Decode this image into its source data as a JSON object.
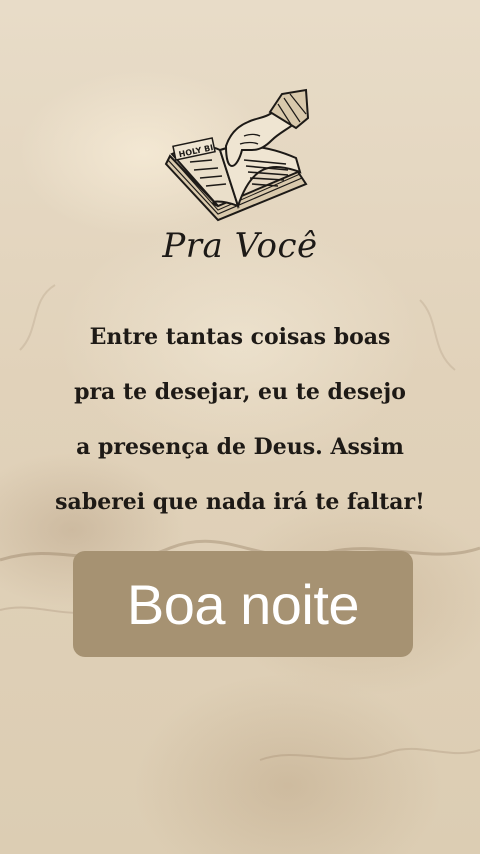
{
  "card": {
    "icon": "open-bible-hand-icon",
    "book_label": "HOLY BI",
    "title": "Pra Você",
    "message_lines": [
      "Entre tantas coisas boas",
      "pra te desejar, eu te desejo",
      "a presença de Deus. Assim",
      "saberei que nada irá te faltar!"
    ],
    "banner": {
      "label": "Boa noite",
      "color": "#a69272"
    }
  },
  "colors": {
    "parchment": "#e1d2ba",
    "text": "#1e1a16"
  }
}
